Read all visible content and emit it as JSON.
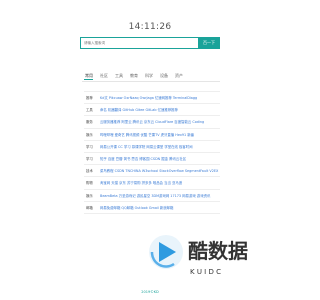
{
  "clock": "14:11:26",
  "search": {
    "placeholder": "请输入搜索词",
    "button_label": "百一下"
  },
  "tabs": [
    "常用",
    "社区",
    "工具",
    "教育",
    "科学",
    "设备",
    "资产"
  ],
  "nav_rows": [
    {
      "category": "推荐",
      "links": "Kd文 Pikcuaw OxrNaaq OwrJaga 亿速网推荐 TerminalDiagg",
      "bold_tail": true
    },
    {
      "category": "工具",
      "links": "命名 机器翻译 GitHub Gitee GitLab 亿速推荐推荐"
    },
    {
      "category": "服务",
      "links": "云服务器推荐 阿里云 腾讯云 京东云 CloudFlare 百度智能云 Coding"
    },
    {
      "category": "娱乐",
      "links": "哔哩哔哩 爱奇艺 腾讯视频 优酷 芒果TV 虎牙直播 Hex91 新番"
    },
    {
      "category": "学习",
      "links": "网易公开课 CC 学习 慕课学院 网易云课堂 学堂在线 极客时间"
    },
    {
      "category": "学习",
      "links": "知乎 百度 豆瓣 简书 思否 博客园 CSDN 掘金 腾讯云社区"
    },
    {
      "category": "技术",
      "links": "菜鸟教程 CSDN TNCHINA W3school StackOverflow SegmentFault V2EX"
    },
    {
      "category": "购物",
      "links": "淘宝网 天猫 京东 苏宁易购 拼多多 唯品会 当当 亚马逊"
    },
    {
      "category": "娱乐",
      "links": "BeamBeta 万圣游戏记 游民星空 3DM游戏网 17173 网易游戏 游戏资讯"
    },
    {
      "category": "邮箱",
      "links": "网易免费邮箱 QQ邮箱 Outlook Gmail 新浪邮箱"
    }
  ],
  "footer": "2019©KD",
  "watermark": {
    "text": "酷数据",
    "subtext": "K U I D C"
  },
  "colors": {
    "accent": "#1aa39a",
    "link": "#3a7bd5"
  }
}
